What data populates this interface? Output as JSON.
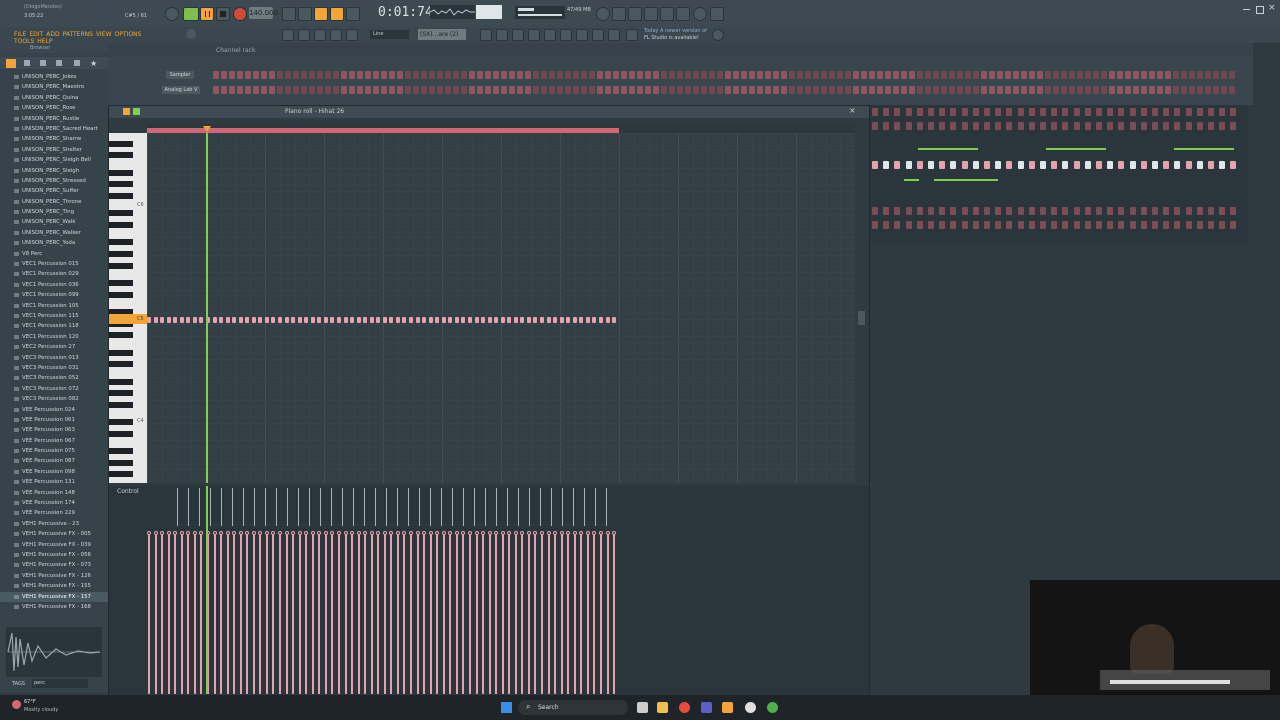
{
  "titlebar": {
    "project": "(DiogoMendes)",
    "time_small": "3:05:22",
    "pattern_info": "C#5 / 61",
    "tempo": "140.000",
    "song_time": "0:01:74",
    "cpu": "47/49 MB",
    "news_line1": "Today  A newer version of",
    "news_line2": "FL Studio is available!"
  },
  "menu": {
    "items": [
      "FILE",
      "EDIT",
      "ADD",
      "PATTERNS",
      "VIEW",
      "OPTIONS",
      "TOOLS",
      "HELP"
    ],
    "snap_label": "Line",
    "pattern_selector": "(SX)...are (2)"
  },
  "browser": {
    "header": "Browser",
    "items": [
      "UNISON_PERC_Jokes",
      "UNISON_PERC_Maestro",
      "UNISON_PERC_Quina",
      "UNISON_PERC_Rose",
      "UNISON_PERC_Rustle",
      "UNISON_PERC_Sacred Heart",
      "UNISON_PERC_Shame",
      "UNISON_PERC_Shelter",
      "UNISON_PERC_Sleigh Bell",
      "UNISON_PERC_Sleigh",
      "UNISON_PERC_Stressed",
      "UNISON_PERC_Suffer",
      "UNISON_PERC_Throne",
      "UNISON_PERC_Ting",
      "UNISON_PERC_Walk",
      "UNISON_PERC_Walker",
      "UNISON_PERC_Yoda",
      "V8 Perc",
      "VEC1 Percussion 015",
      "VEC1 Percussion 029",
      "VEC1 Percussion 036",
      "VEC1 Percussion 099",
      "VEC1 Percussion 105",
      "VEC1 Percussion 115",
      "VEC1 Percussion 118",
      "VEC1 Percussion 120",
      "VEC2 Percussion 27",
      "VEC3 Percussion 013",
      "VEC3 Percussion 031",
      "VEC3 Percussion 052",
      "VEC3 Percussion 072",
      "VEC3 Percussion 082",
      "VEE Percussion 024",
      "VEE Percussion 061",
      "VEE Percussion 063",
      "VEE Percussion 067",
      "VEE Percussion 075",
      "VEE Percussion 087",
      "VEE Percussion 098",
      "VEE Percussion 131",
      "VEE Percussion 148",
      "VEE Percussion 174",
      "VEE Percussion 229",
      "VEH1 Percussive - 23",
      "VEH1 Percussive FX - 005",
      "VEH1 Percussive FX - 039",
      "VEH1 Percussive FX - 056",
      "VEH1 Percussive FX - 073",
      "VEH1 Percussive FX - 126",
      "VEH1 Percussive FX - 155",
      "VEH1 Percussive FX - 157",
      "VEH1 Percussive FX - 168"
    ],
    "selected_index": 50,
    "tags_label": "TAGS",
    "search_value": "perc"
  },
  "channel_rack": {
    "title": "Channel rack",
    "channels": [
      "Sampler",
      "Analog Lab V"
    ]
  },
  "piano_roll": {
    "title": "Piano roll - Hihat 26",
    "control_label": "Control",
    "octave_labels": [
      "C6",
      "C5",
      "C4"
    ],
    "note_label": "C5",
    "note_count": 72
  },
  "taskbar": {
    "weather_temp": "67°F",
    "weather_desc": "Mostly cloudy",
    "search_label": "Search"
  },
  "colors": {
    "accent_orange": "#f3a53a",
    "note_pink": "#e6a3ad",
    "playhead_green": "#7fd04e",
    "pattern_bar": "#d06878"
  }
}
